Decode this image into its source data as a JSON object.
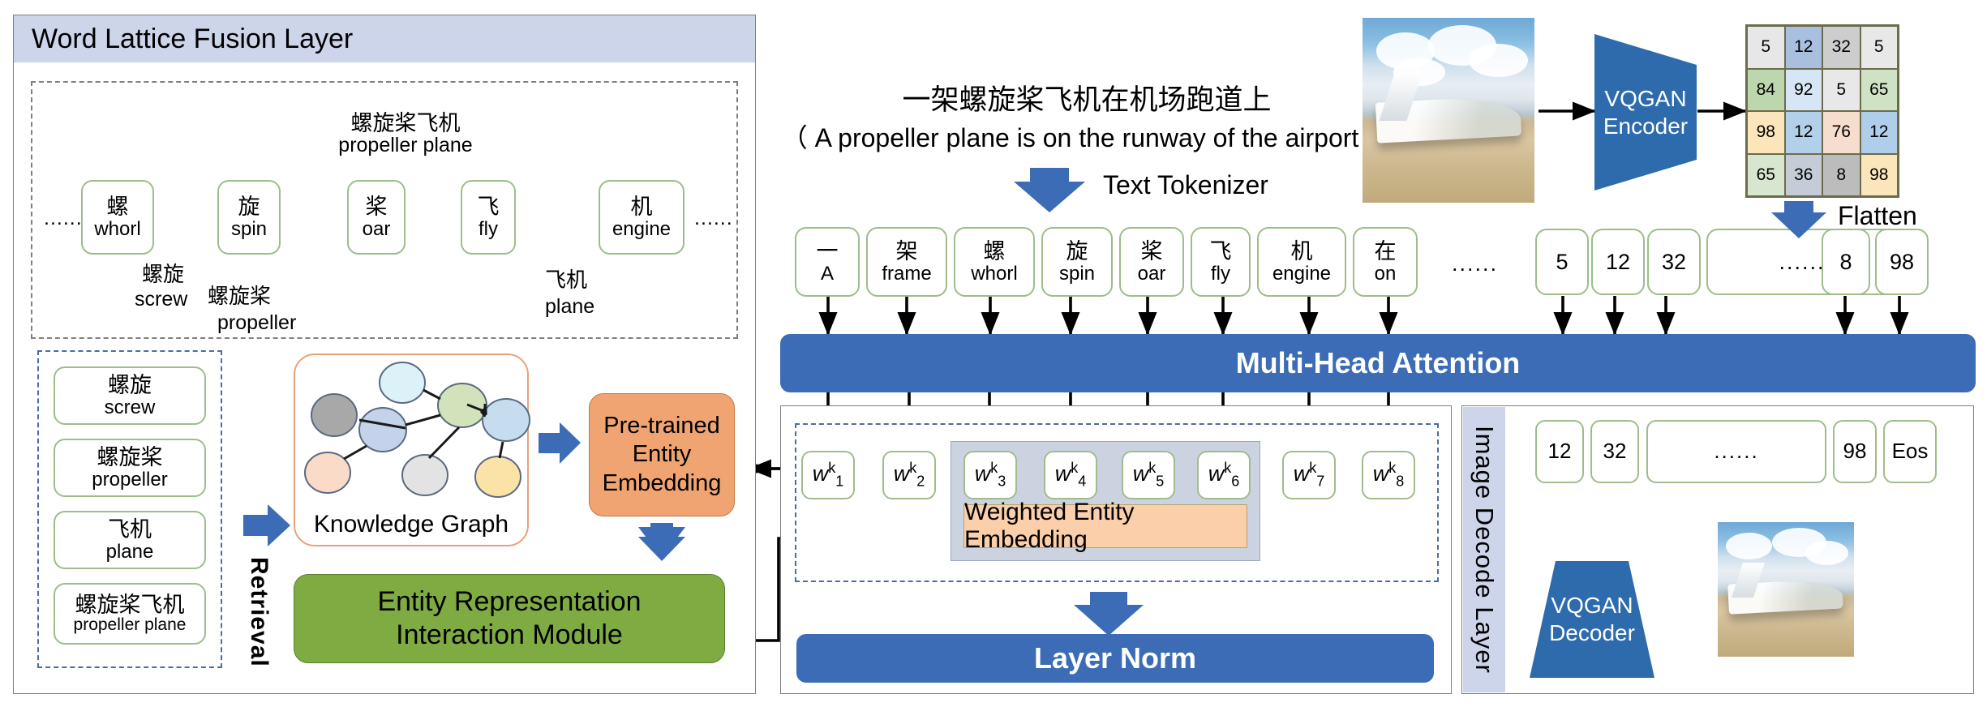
{
  "left_panel": {
    "title": "Word Lattice Fusion Layer",
    "lattice": {
      "ellipsis_left": "......",
      "ellipsis_right": "......",
      "nodes": [
        {
          "cn": "螺",
          "en": "whorl"
        },
        {
          "cn": "旋",
          "en": "spin"
        },
        {
          "cn": "桨",
          "en": "oar"
        },
        {
          "cn": "飞",
          "en": "fly"
        },
        {
          "cn": "机",
          "en": "engine"
        }
      ],
      "arcs": [
        {
          "cn": "螺旋桨飞机",
          "en": "propeller plane"
        },
        {
          "cn": "螺旋",
          "en": "screw"
        },
        {
          "cn": "螺旋桨",
          "en": "propeller"
        },
        {
          "cn": "飞机",
          "en": "plane"
        }
      ]
    },
    "entity_list": [
      {
        "cn": "螺旋",
        "en": "screw"
      },
      {
        "cn": "螺旋桨",
        "en": "propeller"
      },
      {
        "cn": "飞机",
        "en": "plane"
      },
      {
        "cn": "螺旋桨飞机",
        "en": "propeller plane"
      }
    ],
    "retrieval_label": "Retrieval",
    "knowledge_graph_label": "Knowledge Graph",
    "pretrained_entity_embedding": [
      "Pre-trained",
      "Entity",
      "Embedding"
    ],
    "entity_module": [
      "Entity Representation",
      "Interaction Module"
    ]
  },
  "center": {
    "caption_cn": "一架螺旋桨飞机在机场跑道上",
    "caption_en": "（ A propeller plane is on the runway of the airport ）",
    "text_tokenizer_label": "Text Tokenizer",
    "text_tokens": [
      {
        "cn": "一",
        "en": "A"
      },
      {
        "cn": "架",
        "en": "frame"
      },
      {
        "cn": "螺",
        "en": "whorl"
      },
      {
        "cn": "旋",
        "en": "spin"
      },
      {
        "cn": "桨",
        "en": "oar"
      },
      {
        "cn": "飞",
        "en": "fly"
      },
      {
        "cn": "机",
        "en": "engine"
      },
      {
        "cn": "在",
        "en": "on"
      }
    ],
    "token_ellipsis": "......",
    "image_tokens": [
      "5",
      "12",
      "32",
      "......",
      "8",
      "98"
    ],
    "multi_head_attention": "Multi-Head Attention",
    "w_tokens": [
      "w",
      "w",
      "w",
      "w",
      "w",
      "w",
      "w",
      "w"
    ],
    "w_subscripts": [
      "1",
      "2",
      "3",
      "4",
      "5",
      "6",
      "7",
      "8"
    ],
    "w_superscript": "k",
    "weighted_entity_embedding": "Weighted Entity Embedding",
    "layer_norm": "Layer Norm"
  },
  "right": {
    "vqgan_encoder": [
      "VQGAN",
      "Encoder"
    ],
    "flatten_label": "Flatten",
    "code_grid": {
      "rows": [
        [
          "5",
          "12",
          "32",
          "5"
        ],
        [
          "84",
          "92",
          "5",
          "65"
        ],
        [
          "98",
          "12",
          "76",
          "12"
        ],
        [
          "65",
          "36",
          "8",
          "98"
        ]
      ],
      "colors": [
        [
          "#e7e7e7",
          "#a8bfe0",
          "#cdcdcd",
          "#e8e8e8"
        ],
        [
          "#bcd6ae",
          "#d6e6f5",
          "#e8e8e8",
          "#cfe3c4"
        ],
        [
          "#fbe5bb",
          "#b2d0e9",
          "#f7ddcd",
          "#aecee9"
        ],
        [
          "#d7e6cf",
          "#c5ccd8",
          "#bcbcbc",
          "#fbe5bb"
        ]
      ]
    },
    "decode_layer_label": "Image Decode Layer",
    "decoded_tokens": [
      "12",
      "32",
      "......",
      "98",
      "Eos"
    ],
    "vqgan_decoder": [
      "VQGAN",
      "Decoder"
    ]
  },
  "colors": {
    "header_blue": "#ccd5ea",
    "bar_blue": "#3b6cb5",
    "arrow_blue": "#3b6cb5",
    "orange": "#f0a472",
    "green": "#7fab43",
    "node_green_outline": "#9ebd8b",
    "weighted_orange": "#fbcfa9",
    "shade_grey": "#ccd3e0"
  }
}
